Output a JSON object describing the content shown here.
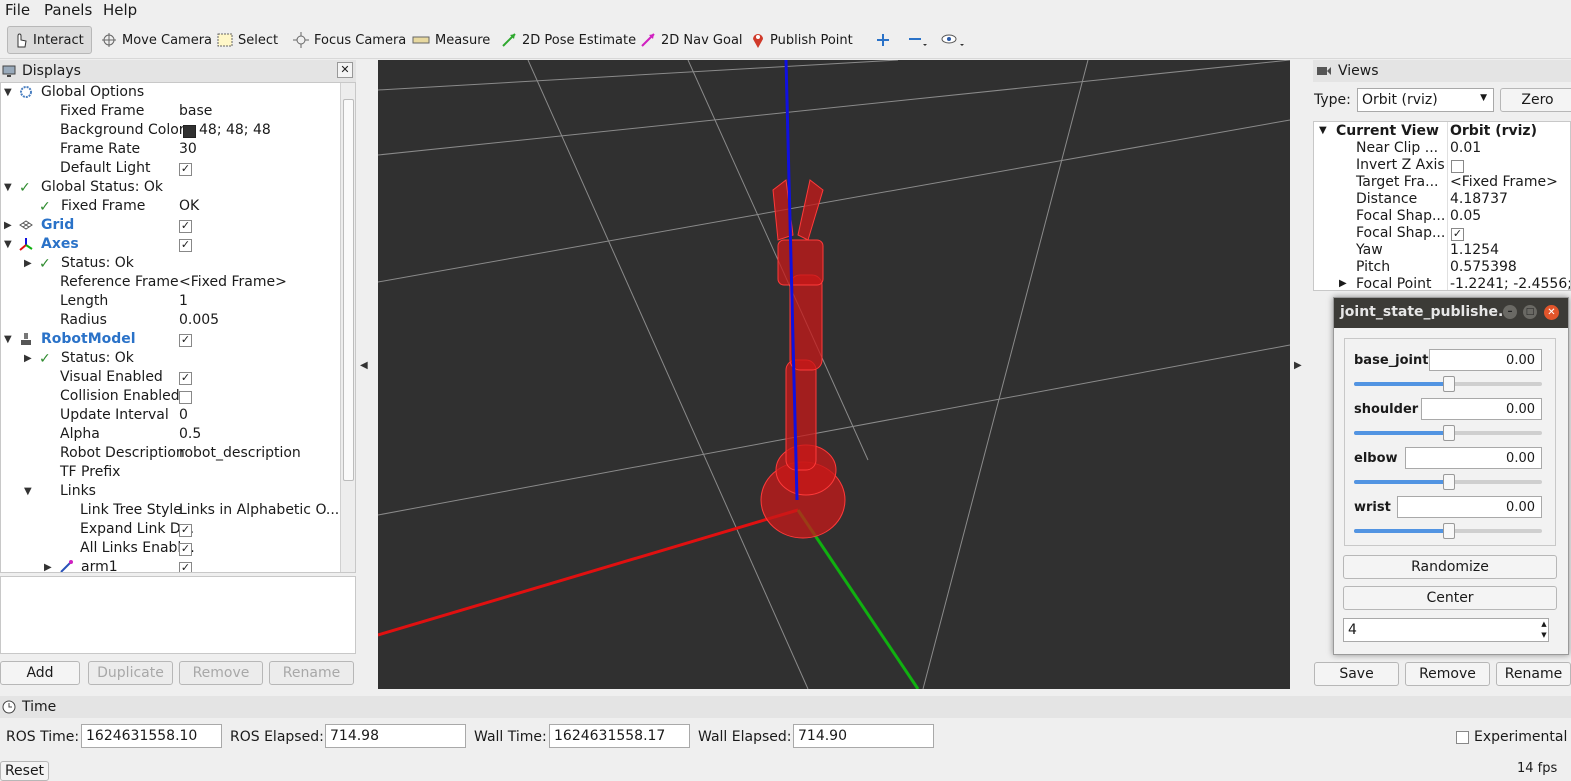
{
  "menu": [
    "File",
    "Panels",
    "Help"
  ],
  "toolbar": {
    "interact": "Interact",
    "move_camera": "Move Camera",
    "select": "Select",
    "focus_camera": "Focus Camera",
    "measure": "Measure",
    "pose_estimate": "2D Pose Estimate",
    "nav_goal": "2D Nav Goal",
    "publish_point": "Publish Point"
  },
  "displays": {
    "title": "Displays",
    "rows": [
      {
        "name": "Global Options",
        "value": ""
      },
      {
        "name": "Fixed Frame",
        "value": "base"
      },
      {
        "name": "Background Color",
        "value": "48; 48; 48"
      },
      {
        "name": "Frame Rate",
        "value": "30"
      },
      {
        "name": "Default Light",
        "value": ""
      },
      {
        "name": "Global Status: Ok",
        "value": ""
      },
      {
        "name": "Fixed Frame",
        "value": "OK"
      },
      {
        "name": "Grid",
        "value": ""
      },
      {
        "name": "Axes",
        "value": ""
      },
      {
        "name": "Status: Ok",
        "value": ""
      },
      {
        "name": "Reference Frame",
        "value": "<Fixed Frame>"
      },
      {
        "name": "Length",
        "value": "1"
      },
      {
        "name": "Radius",
        "value": "0.005"
      },
      {
        "name": "RobotModel",
        "value": ""
      },
      {
        "name": "Status: Ok",
        "value": ""
      },
      {
        "name": "Visual Enabled",
        "value": ""
      },
      {
        "name": "Collision Enabled",
        "value": ""
      },
      {
        "name": "Update Interval",
        "value": "0"
      },
      {
        "name": "Alpha",
        "value": "0.5"
      },
      {
        "name": "Robot Description",
        "value": "robot_description"
      },
      {
        "name": "TF Prefix",
        "value": ""
      },
      {
        "name": "Links",
        "value": ""
      },
      {
        "name": "Link Tree Style",
        "value": "Links in Alphabetic O..."
      },
      {
        "name": "Expand Link D...",
        "value": ""
      },
      {
        "name": "All Links Enabl...",
        "value": ""
      },
      {
        "name": "arm1",
        "value": ""
      }
    ],
    "buttons": {
      "add": "Add",
      "duplicate": "Duplicate",
      "remove": "Remove",
      "rename": "Rename"
    }
  },
  "views": {
    "title": "Views",
    "type_label": "Type:",
    "type_value": "Orbit (rviz)",
    "zero": "Zero",
    "rows": [
      {
        "name": "Current View",
        "value": "Orbit (rviz)"
      },
      {
        "name": "Near Clip ...",
        "value": "0.01"
      },
      {
        "name": "Invert Z Axis",
        "value": ""
      },
      {
        "name": "Target Fra...",
        "value": "<Fixed Frame>"
      },
      {
        "name": "Distance",
        "value": "4.18737"
      },
      {
        "name": "Focal Shap...",
        "value": "0.05"
      },
      {
        "name": "Focal Shap...",
        "value": ""
      },
      {
        "name": "Yaw",
        "value": "1.1254"
      },
      {
        "name": "Pitch",
        "value": "0.575398"
      },
      {
        "name": "Focal Point",
        "value": "-1.2241; -2.4556;..."
      }
    ],
    "buttons": {
      "save": "Save",
      "remove": "Remove",
      "rename": "Rename"
    }
  },
  "dialog": {
    "title": "joint_state_publishe...",
    "joints": [
      {
        "name": "base_joint",
        "value": "0.00",
        "position": 0.5
      },
      {
        "name": "shoulder",
        "value": "0.00",
        "position": 0.5
      },
      {
        "name": "elbow",
        "value": "0.00",
        "position": 0.5
      },
      {
        "name": "wrist",
        "value": "0.00",
        "position": 0.5
      }
    ],
    "randomize": "Randomize",
    "center": "Center",
    "spin_value": "4"
  },
  "time": {
    "title": "Time",
    "ros_time_label": "ROS Time:",
    "ros_time": "1624631558.10",
    "ros_elapsed_label": "ROS Elapsed:",
    "ros_elapsed": "714.98",
    "wall_time_label": "Wall Time:",
    "wall_time": "1624631558.17",
    "wall_elapsed_label": "Wall Elapsed:",
    "wall_elapsed": "714.90",
    "experimental": "Experimental",
    "reset": "Reset",
    "fps": "14 fps"
  },
  "colors": {
    "viewport_bg": "#303030",
    "robot": "#c81818",
    "x_axis": "#e01010",
    "y_axis": "#10b010",
    "z_axis": "#1010e0",
    "accent": "#2a72c8"
  }
}
